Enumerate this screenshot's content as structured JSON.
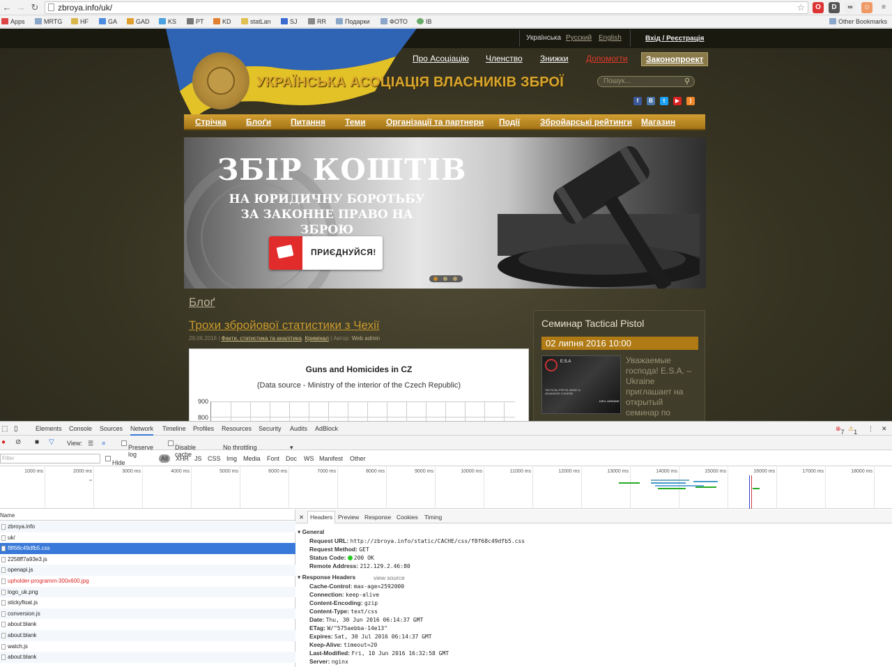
{
  "browser": {
    "url": "zbroya.info/uk/",
    "bookmarks": [
      "Apps",
      "MRTG",
      "HF",
      "GA",
      "GAD",
      "KS",
      "PT",
      "KD",
      "statLan",
      "SJ",
      "RR",
      "Подарки",
      "ФОТО",
      "IB"
    ],
    "other_bookmarks": "Other Bookmarks"
  },
  "site": {
    "langs": [
      "Українська",
      "Русский",
      "English"
    ],
    "login": "Вхід / Реєстрація",
    "title": "УКРАЇНСЬКА АСОЦІАЦІЯ ВЛАСНИКІВ ЗБРОЇ",
    "top_menu": [
      "Про Асоціацію",
      "Членство",
      "Знижки",
      "Допомогти",
      "Законопроект"
    ],
    "search_placeholder": "Пошук...",
    "main_menu": [
      "Стрічка",
      "Блоґи",
      "Питання",
      "Теми",
      "Організації та партнери",
      "Події",
      "Збройарські рейтинги",
      "Магазин"
    ],
    "banner": {
      "heading": "ЗБІР КОШТІВ",
      "subheading": "НА ЮРИДИЧНУ БОРОТЬБУ ЗА ЗАКОННЕ ПРАВО НА ЗБРОЮ",
      "button": "ПРИЄДНУЙСЯ!"
    },
    "blog_heading": "Блоґ",
    "post": {
      "title": "Трохи збройової статистики з Чехії",
      "date": "29.06.2016",
      "categories": "Факти, статистика та аналітика",
      "category2": "Кримінал",
      "author_label": "Автор:",
      "author": "Web admin"
    },
    "chart": {
      "title": "Guns and Homicides in CZ",
      "subtitle": "(Data source - Ministry of the interior of the Czech Republic)",
      "ticks": [
        "900",
        "800"
      ]
    },
    "sidebar": {
      "title": "Семинар Tactical Pistol",
      "date": "02 липня 2016 10:00",
      "text": "Уважаемые господа! E.S.A. – Ukraine приглашает на открытый семинар по",
      "img_badge": "E.S.A",
      "img_caption": "TACTICAL PISTOL BASIC & ADVANCED COURSE",
      "img_city": "KIEV, UKRAINE"
    }
  },
  "devtools": {
    "tabs": [
      "Elements",
      "Console",
      "Sources",
      "Network",
      "Timeline",
      "Profiles",
      "Resources",
      "Security",
      "Audits",
      "AdBlock"
    ],
    "active_tab": "Network",
    "errors": "7",
    "warnings": "1",
    "toolbar": {
      "view": "View:",
      "preserve": "Preserve log",
      "disable_cache": "Disable cache",
      "throttle": "No throttling"
    },
    "filter": {
      "placeholder": "Filter",
      "hide_data": "Hide data URLs",
      "all": "All",
      "types": [
        "XHR",
        "JS",
        "CSS",
        "Img",
        "Media",
        "Font",
        "Doc",
        "WS",
        "Manifest",
        "Other"
      ]
    },
    "timeline_labels": [
      "1000 ms",
      "2000 ms",
      "3000 ms",
      "4000 ms",
      "5000 ms",
      "6000 ms",
      "7000 ms",
      "8000 ms",
      "9000 ms",
      "10000 ms",
      "11000 ms",
      "12000 ms",
      "13000 ms",
      "14000 ms",
      "15000 ms",
      "16000 ms",
      "17000 ms",
      "18000 ms"
    ],
    "requests_header": "Name",
    "requests": [
      "zbroya.info",
      "uk/",
      "f8f68c49dfb5.css",
      "2258ff7a93e3.js",
      "openapi.js",
      "upholder-programm-300x600.jpg",
      "logo_uk.png",
      "stickyfloat.js",
      "conversion.js",
      "about:blank",
      "about:blank",
      "watch.js",
      "about:blank"
    ],
    "detail_tabs": [
      "Headers",
      "Preview",
      "Response",
      "Cookies",
      "Timing"
    ],
    "general": {
      "label": "General",
      "rows": [
        {
          "k": "Request URL:",
          "v": "http://zbroya.info/static/CACHE/css/f8f68c49dfb5.css"
        },
        {
          "k": "Request Method:",
          "v": "GET"
        },
        {
          "k": "Status Code:",
          "v": "200 OK"
        },
        {
          "k": "Remote Address:",
          "v": "212.129.2.46:80"
        }
      ]
    },
    "response_headers": {
      "label": "Response Headers",
      "view_source": "view source",
      "rows": [
        {
          "k": "Cache-Control:",
          "v": "max-age=2592000"
        },
        {
          "k": "Connection:",
          "v": "keep-alive"
        },
        {
          "k": "Content-Encoding:",
          "v": "gzip"
        },
        {
          "k": "Content-Type:",
          "v": "text/css"
        },
        {
          "k": "Date:",
          "v": "Thu, 30 Jun 2016 06:14:37 GMT"
        },
        {
          "k": "ETag:",
          "v": "W/\"575aebba-14e13\""
        },
        {
          "k": "Expires:",
          "v": "Sat, 30 Jul 2016 06:14:37 GMT"
        },
        {
          "k": "Keep-Alive:",
          "v": "timeout=20"
        },
        {
          "k": "Last-Modified:",
          "v": "Fri, 10 Jun 2016 16:32:58 GMT"
        },
        {
          "k": "Server:",
          "v": "nginx"
        }
      ]
    }
  }
}
